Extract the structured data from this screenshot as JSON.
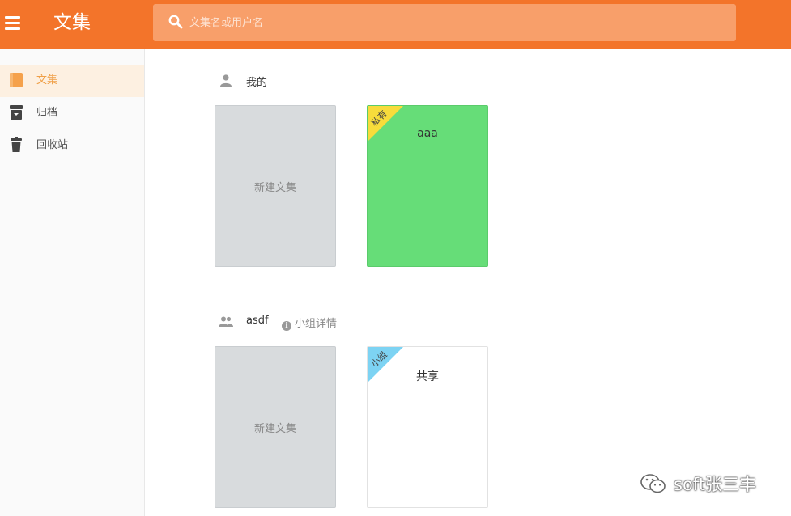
{
  "header": {
    "title": "文集",
    "search_placeholder": "文集名或用户名"
  },
  "sidebar": {
    "items": [
      {
        "label": "文集",
        "icon": "book-icon",
        "active": true
      },
      {
        "label": "归档",
        "icon": "archive-icon",
        "active": false
      },
      {
        "label": "回收站",
        "icon": "trash-icon",
        "active": false
      }
    ]
  },
  "groups": [
    {
      "name": "我的",
      "icon": "user-icon",
      "cards": [
        {
          "label": "新建文集",
          "kind": "new"
        },
        {
          "label": "aaa",
          "kind": "collection",
          "color": "#66dd78",
          "ribbon": "私有",
          "ribbon_color": "#f7dc3b"
        }
      ]
    },
    {
      "name": "asdf",
      "icon": "users-icon",
      "detail_link": "小组详情",
      "cards": [
        {
          "label": "新建文集",
          "kind": "new"
        },
        {
          "label": "共享",
          "kind": "collection",
          "color": "#ffffff",
          "ribbon": "小组",
          "ribbon_color": "#7dd3f3"
        }
      ]
    }
  ],
  "watermark": {
    "text": "soft张三丰",
    "icon": "wechat-icon"
  },
  "colors": {
    "accent": "#f3742a",
    "search_bg": "#f89f6a",
    "active_item_bg": "#fdf0e1",
    "active_item_text": "#f0a048"
  }
}
